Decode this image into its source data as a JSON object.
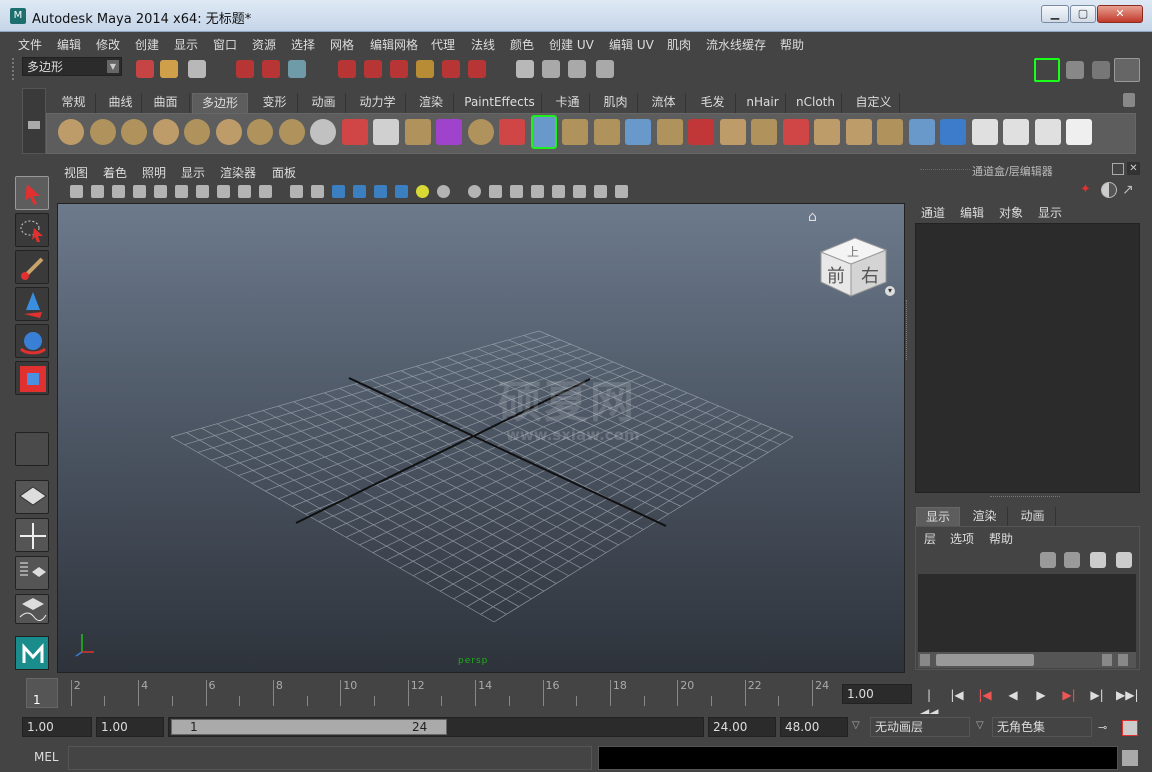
{
  "window": {
    "title": "Autodesk Maya 2014 x64: 无标题*",
    "logo_text": "M"
  },
  "menu": [
    "文件",
    "编辑",
    "修改",
    "创建",
    "显示",
    "窗口",
    "资源",
    "选择",
    "网格",
    "编辑网格",
    "代理",
    "法线",
    "颜色",
    "创建 UV",
    "编辑 UV",
    "肌肉",
    "流水线缓存",
    "帮助"
  ],
  "mode_select": {
    "value": "多边形"
  },
  "shelf_tabs": [
    "常规",
    "曲线",
    "曲面",
    "多边形",
    "变形",
    "动画",
    "动力学",
    "渲染",
    "PaintEffects",
    "卡通",
    "肌肉",
    "流体",
    "毛发",
    "nHair",
    "nCloth",
    "自定义"
  ],
  "shelf_active": "多边形",
  "viewport": {
    "menu": [
      "视图",
      "着色",
      "照明",
      "显示",
      "渲染器",
      "面板"
    ],
    "viewcube": {
      "front": "前",
      "right": "右",
      "top": "上"
    },
    "camera_label": "persp",
    "watermark": {
      "title": "硕夏网",
      "url": "www.sxiaw.com"
    }
  },
  "channel_box": {
    "title": "通道盒/层编辑器",
    "menu": [
      "通道",
      "编辑",
      "对象",
      "显示"
    ],
    "layer_tabs": [
      "显示",
      "渲染",
      "动画"
    ],
    "layer_menu": [
      "层",
      "选项",
      "帮助"
    ]
  },
  "timeline": {
    "ticks": [
      "2",
      "4",
      "6",
      "8",
      "10",
      "12",
      "14",
      "16",
      "18",
      "20",
      "22",
      "24"
    ],
    "current_frame": "1",
    "current_time_field": "1.00"
  },
  "range": {
    "start_field": "1.00",
    "playback_start": "1.00",
    "slider_start": "1",
    "slider_end": "24",
    "playback_end": "24.00",
    "end_field": "48.00",
    "anim_layer": "无动画层",
    "char_set": "无角色集"
  },
  "command_line": {
    "label": "MEL"
  },
  "colors": {
    "accent_green": "#19ff19",
    "ui_bg": "#444444",
    "field_bg": "#2b2b2b"
  }
}
